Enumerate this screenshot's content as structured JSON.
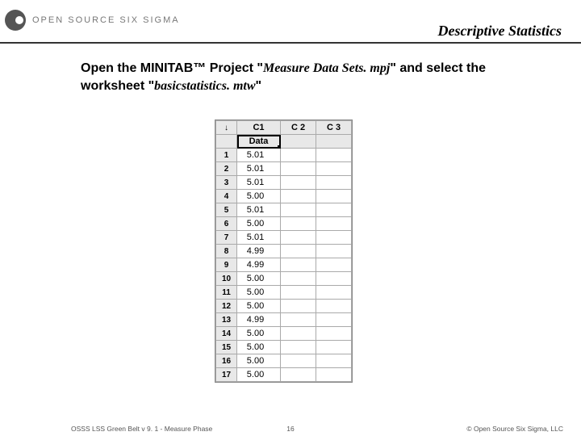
{
  "header": {
    "logo_text": "OPEN SOURCE SIX SIGMA",
    "page_title": "Descriptive Statistics"
  },
  "instruction": {
    "t1": "Open the MINITAB™ Project \"",
    "file1": "Measure Data Sets. mpj",
    "t2": "\" and select the worksheet \"",
    "file2": "basicstatistics. mtw",
    "t3": "\""
  },
  "table": {
    "corner": "↓",
    "col_headers": [
      "C1",
      "C 2",
      "C 3"
    ],
    "name_row": [
      "Data",
      "",
      ""
    ],
    "rows": [
      {
        "n": "1",
        "v": "5.01"
      },
      {
        "n": "2",
        "v": "5.01"
      },
      {
        "n": "3",
        "v": "5.01"
      },
      {
        "n": "4",
        "v": "5.00"
      },
      {
        "n": "5",
        "v": "5.01"
      },
      {
        "n": "6",
        "v": "5.00"
      },
      {
        "n": "7",
        "v": "5.01"
      },
      {
        "n": "8",
        "v": "4.99"
      },
      {
        "n": "9",
        "v": "4.99"
      },
      {
        "n": "10",
        "v": "5.00"
      },
      {
        "n": "11",
        "v": "5.00"
      },
      {
        "n": "12",
        "v": "5.00"
      },
      {
        "n": "13",
        "v": "4.99"
      },
      {
        "n": "14",
        "v": "5.00"
      },
      {
        "n": "15",
        "v": "5.00"
      },
      {
        "n": "16",
        "v": "5.00"
      },
      {
        "n": "17",
        "v": "5.00"
      }
    ]
  },
  "footer": {
    "left": "OSSS LSS Green Belt v 9. 1 - Measure Phase",
    "center": "16",
    "right": "© Open Source Six Sigma, LLC"
  }
}
